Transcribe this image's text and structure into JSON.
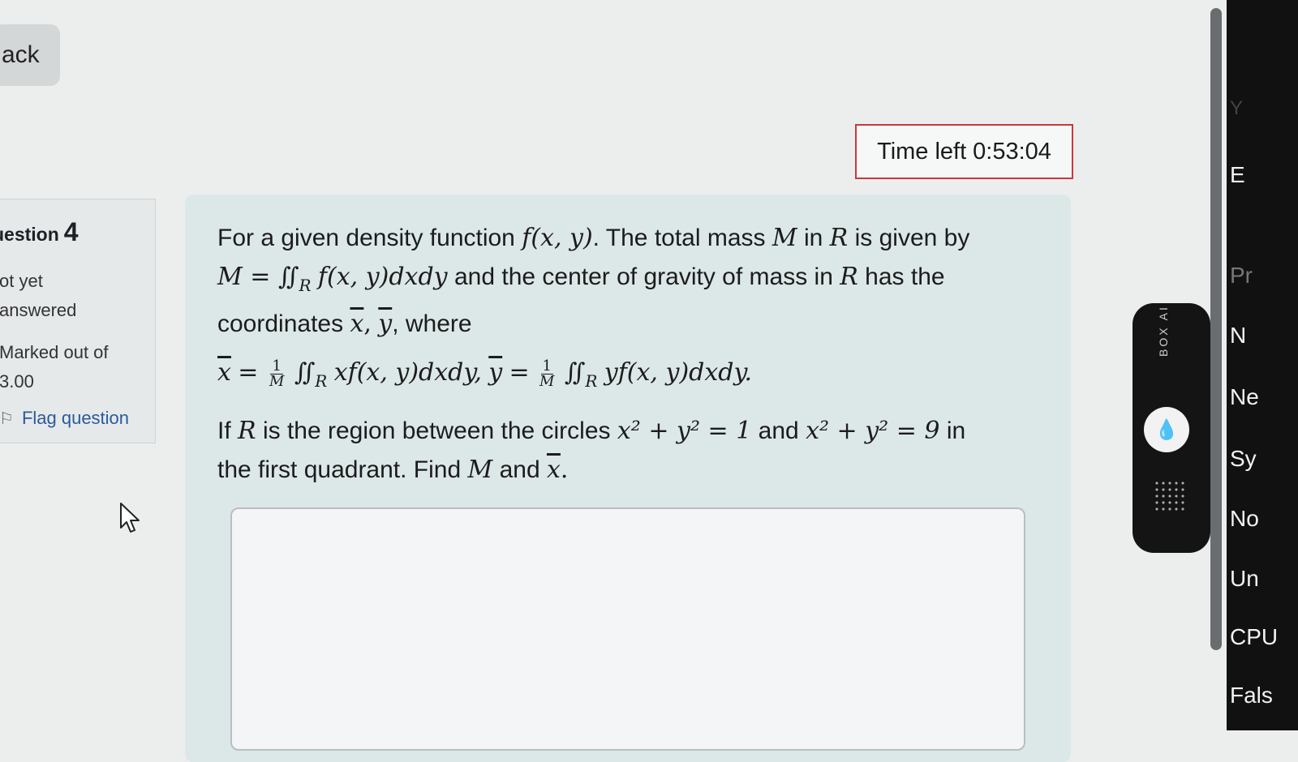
{
  "nav": {
    "back_label": "ack"
  },
  "timer": {
    "label": "Time left",
    "value": "0:53:04"
  },
  "question_info": {
    "prefix": "uestion",
    "number": "4",
    "state_line1": "ot yet",
    "state_line2": "answered",
    "mark_line1": "Marked out of",
    "mark_line2": "3.00",
    "flag_label": "Flag question"
  },
  "question": {
    "line1_a": "For a given density function",
    "fxy": "f(x, y)",
    "line1_b": ". The total mass",
    "M": "M",
    "line1_c": "in",
    "R": "R",
    "line1_d": "is given by",
    "line2_eq": "M = ∬",
    "line2_tail": "f(x, y)dxdy",
    "line2_b": "and the center of gravity of mass in",
    "line2_c": "has the",
    "line3_a": "coordinates",
    "xbar": "x",
    "ybar": "y",
    "comma": ",",
    "line3_b": ", where",
    "f_lhs": "= ",
    "one": "1",
    "M_den": "M",
    "f_int1": "∬",
    "f_term1": "xf(x, y)dxdy,",
    "f_eq2": "=",
    "f_term2": "yf(x, y)dxdy.",
    "p2_a": "If",
    "p2_b": "is the region between the circles",
    "c1": "x² + y² = 1",
    "p2_c": "and",
    "c2": "x² + y² = 9",
    "p2_d": "in",
    "p2_e": "the first quadrant. Find",
    "p2_f": "and",
    "period": "."
  },
  "side_widget": {
    "text": "BOX AI"
  },
  "right_panel": {
    "items": [
      "Y",
      "E",
      "Pr",
      "N",
      "Ne",
      "Sy",
      "No",
      "Un",
      "CPU",
      "Fals"
    ]
  }
}
